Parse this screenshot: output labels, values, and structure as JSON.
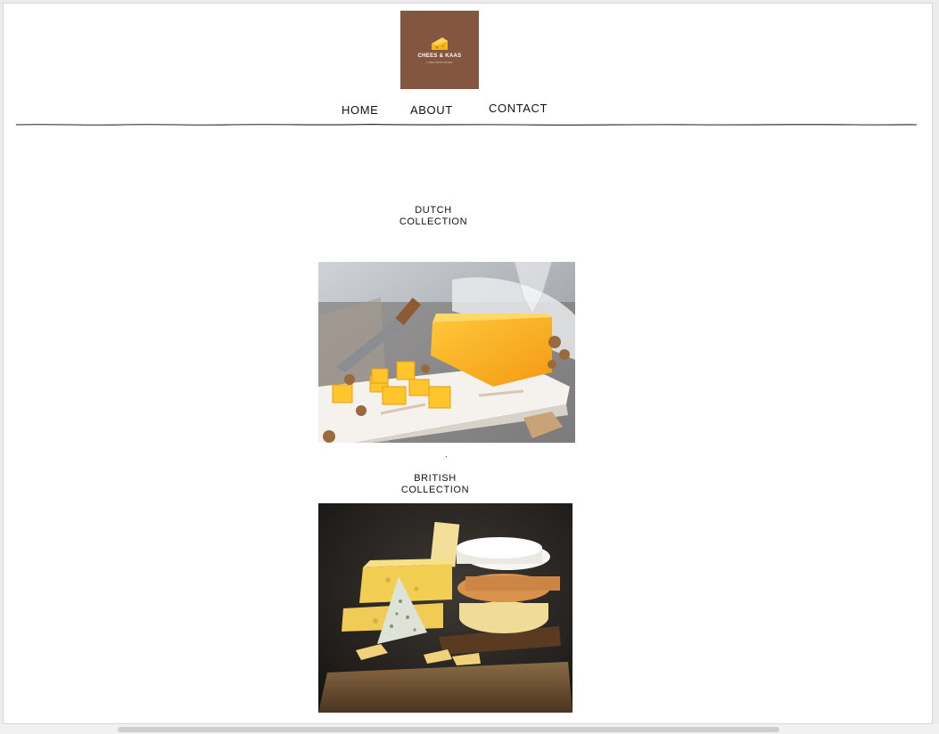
{
  "logo": {
    "title": "CHEES & KAAS",
    "subtitle": "CHEESEMONGER",
    "image_label": "cheese-wedge-logo"
  },
  "nav": {
    "items": [
      "HOME",
      "ABOUT",
      "CONTACT"
    ]
  },
  "collections": [
    {
      "title": "DUTCH\nCOLLECTION",
      "image": "dutch-cheese-board-photo"
    },
    {
      "title": "BRITISH\nCOLLECTION",
      "image": "british-cheese-stack-photo"
    }
  ],
  "colors": {
    "logo_bg": "#83563f",
    "page_bg": "#ffffff",
    "text": "#111111"
  }
}
